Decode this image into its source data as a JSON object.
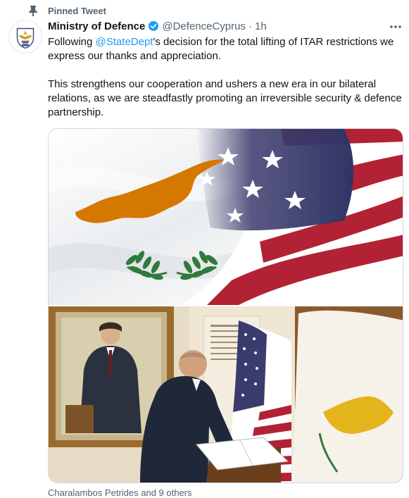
{
  "pinned": {
    "label": "Pinned Tweet",
    "icon": "pin-icon"
  },
  "author": {
    "display_name": "Ministry of Defence",
    "handle": "@DefenceCyprus",
    "separator": "·",
    "time": "1h",
    "verified": true,
    "avatar_icon": "ministry-crest-icon"
  },
  "tweet": {
    "p1_before": "Following ",
    "p1_mention": "@StateDept",
    "p1_after": "'s decision for the total lifting of ITAR restrictions we express our thanks and appreciation.",
    "p2": "This strengthens our cooperation and ushers a new era in our bilateral relations, as we are steadfastly  promoting an irreversible security & defence partnership."
  },
  "media": {
    "image1": "cyprus-us-flags-photo",
    "image2": "minister-signing-guestbook-photo"
  },
  "liked_by": "Charalambos Petrides and 9 others",
  "colors": {
    "accent": "#1d9bf0",
    "text": "#0f1419",
    "secondary": "#536471",
    "cyprus_orange": "#d57800",
    "olive_green": "#2f7a3c",
    "us_red": "#b22234",
    "us_blue": "#3c3b6e"
  }
}
